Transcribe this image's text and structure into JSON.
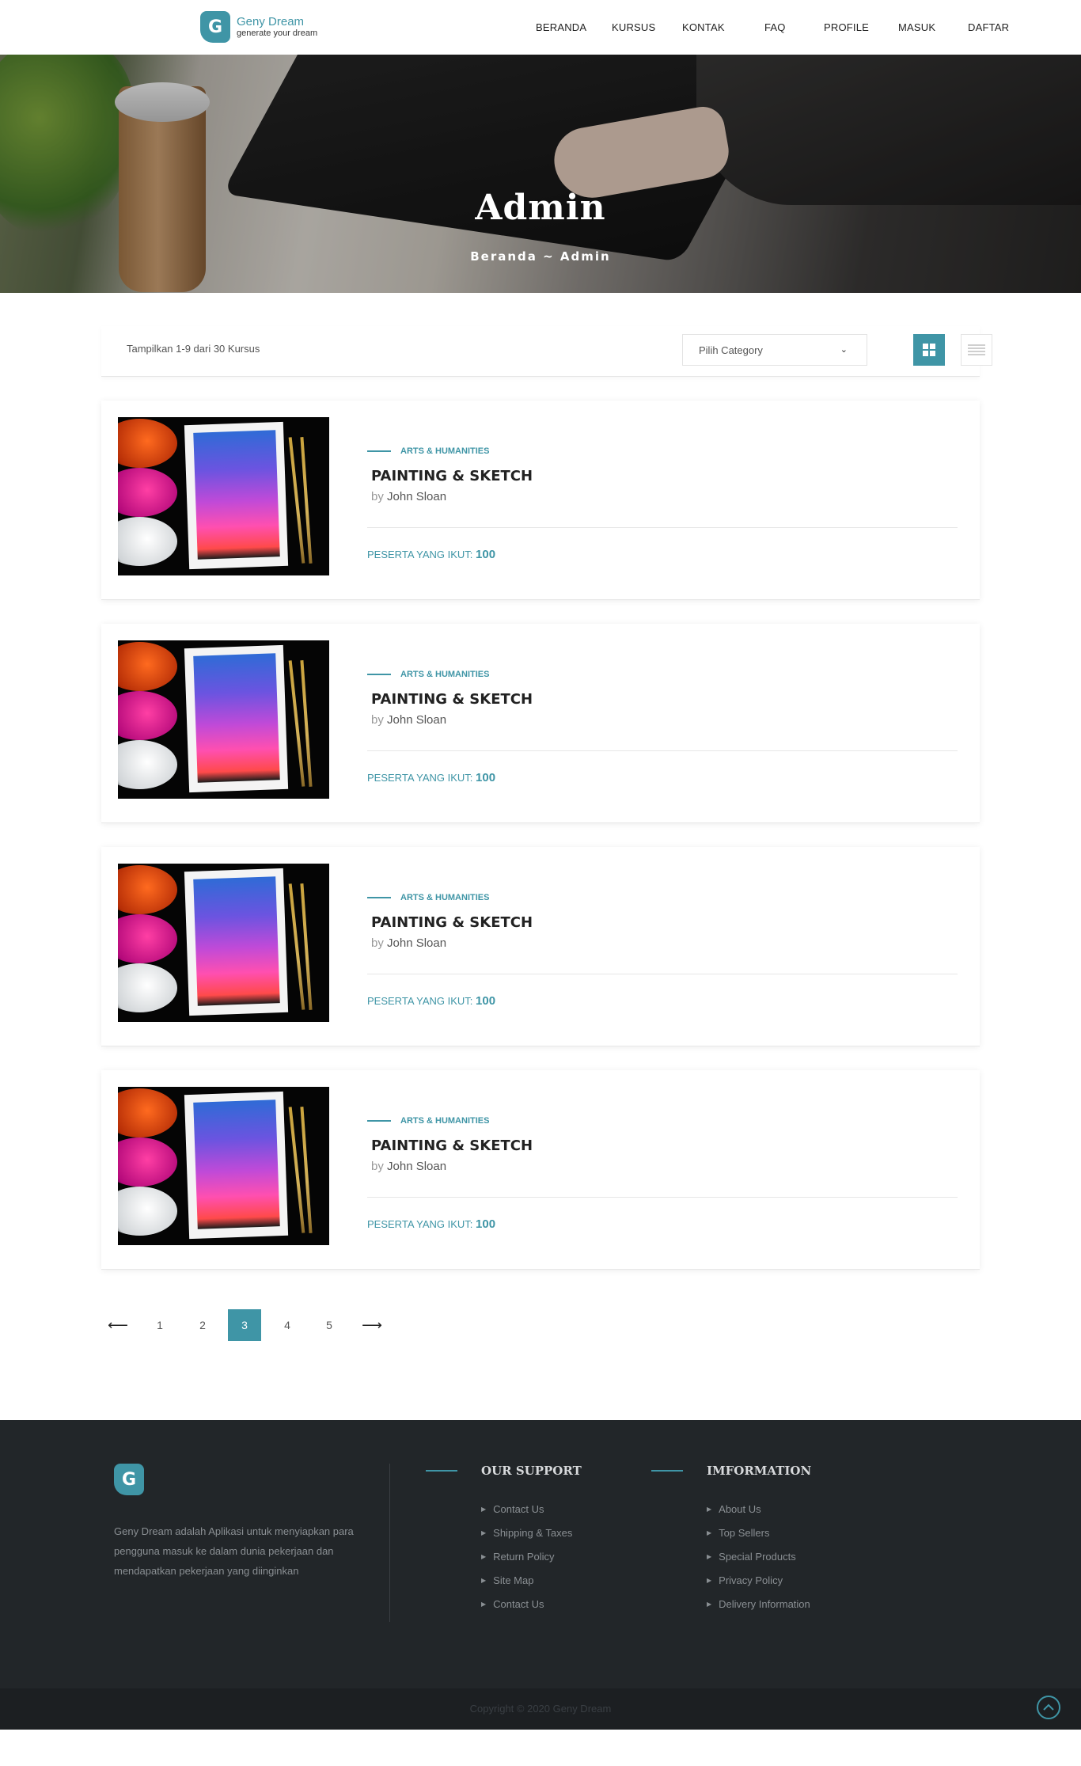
{
  "brand": {
    "name": "Geny Dream",
    "tagline": "generate your dream",
    "initial": "G"
  },
  "nav": [
    "BERANDA",
    "KURSUS",
    "KONTAK",
    "FAQ",
    "PROFILE",
    "MASUK",
    "DAFTAR"
  ],
  "hero": {
    "title": "Admin",
    "breadcrumb": "Beranda ~ Admin"
  },
  "filter": {
    "showing": "Tampilkan 1-9 dari 30 Kursus",
    "category_value": "Pilih Category",
    "grid_view_icon": "grid-icon",
    "list_view_icon": "list-icon"
  },
  "courses": [
    {
      "category": "ARTS & HUMANITIES",
      "title": "PAINTING & SKETCH",
      "by": "by",
      "author": "John Sloan",
      "peserta_label": "PESERTA YANG IKUT:",
      "peserta": "100"
    },
    {
      "category": "ARTS & HUMANITIES",
      "title": "PAINTING & SKETCH",
      "by": "by",
      "author": "John Sloan",
      "peserta_label": "PESERTA YANG IKUT:",
      "peserta": "100"
    },
    {
      "category": "ARTS & HUMANITIES",
      "title": "PAINTING & SKETCH",
      "by": "by",
      "author": "John Sloan",
      "peserta_label": "PESERTA YANG IKUT:",
      "peserta": "100"
    },
    {
      "category": "ARTS & HUMANITIES",
      "title": "PAINTING & SKETCH",
      "by": "by",
      "author": "John Sloan",
      "peserta_label": "PESERTA YANG IKUT:",
      "peserta": "100"
    }
  ],
  "pagination": {
    "prev": "⟵",
    "pages": [
      "1",
      "2",
      "3",
      "4",
      "5"
    ],
    "active": "3",
    "next": "⟶"
  },
  "footer": {
    "about": "Geny Dream adalah Aplikasi untuk menyiapkan para pengguna masuk ke dalam dunia pekerjaan dan mendapatkan pekerjaan yang diinginkan",
    "support": {
      "heading": "OUR SUPPORT",
      "links": [
        "Contact Us",
        "Shipping & Taxes",
        "Return Policy",
        "Site Map",
        "Contact Us"
      ]
    },
    "information": {
      "heading": "IMFORMATION",
      "links": [
        "About Us",
        "Top Sellers",
        "Special Products",
        "Privacy Policy",
        "Delivery Information"
      ]
    },
    "copyright": "Copyright © 2020 Geny Dream"
  },
  "colors": {
    "accent": "#3f95a6",
    "footer_bg": "#222629"
  }
}
